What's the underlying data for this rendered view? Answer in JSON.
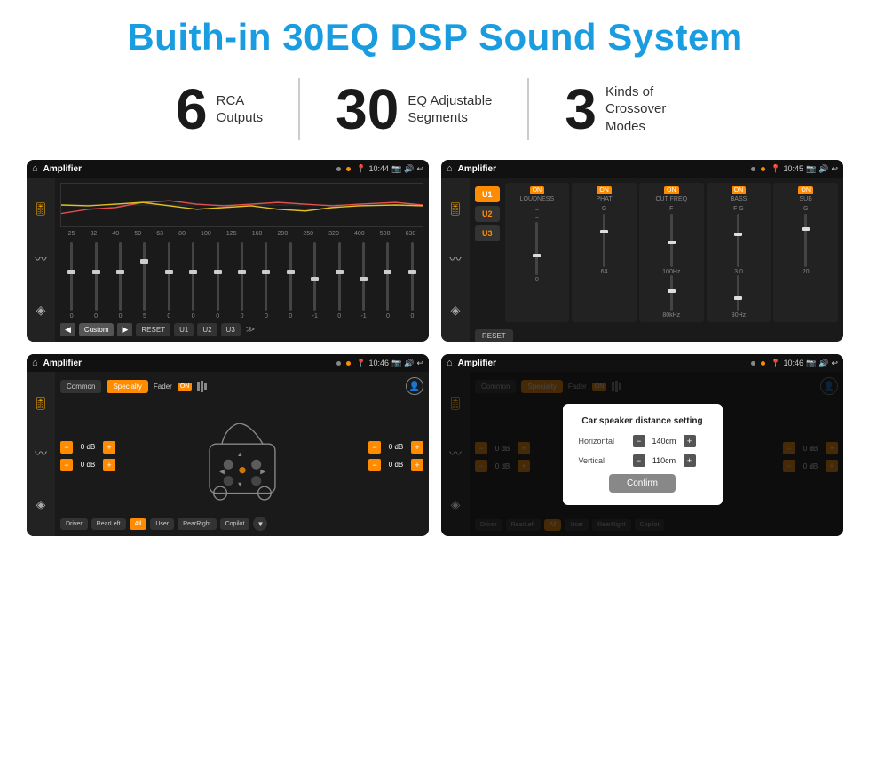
{
  "page": {
    "title": "Buith-in 30EQ DSP Sound System",
    "stats": [
      {
        "number": "6",
        "label": "RCA\nOutputs"
      },
      {
        "number": "30",
        "label": "EQ Adjustable\nSegments"
      },
      {
        "number": "3",
        "label": "Kinds of\nCrossover Modes"
      }
    ],
    "screens": [
      {
        "id": "screen1",
        "statusbar": {
          "title": "Amplifier",
          "time": "10:44"
        },
        "type": "eq"
      },
      {
        "id": "screen2",
        "statusbar": {
          "title": "Amplifier",
          "time": "10:45"
        },
        "type": "amplifier"
      },
      {
        "id": "screen3",
        "statusbar": {
          "title": "Amplifier",
          "time": "10:46"
        },
        "type": "crossover"
      },
      {
        "id": "screen4",
        "statusbar": {
          "title": "Amplifier",
          "time": "10:46"
        },
        "type": "crossover-dialog"
      }
    ],
    "eq": {
      "freqs": [
        "25",
        "32",
        "40",
        "50",
        "63",
        "80",
        "100",
        "125",
        "160",
        "200",
        "250",
        "320",
        "400",
        "500",
        "630"
      ],
      "values": [
        "0",
        "0",
        "0",
        "5",
        "0",
        "0",
        "0",
        "0",
        "0",
        "0",
        "-1",
        "0",
        "-1"
      ],
      "preset": "Custom",
      "buttons": [
        "RESET",
        "U1",
        "U2",
        "U3"
      ]
    },
    "amplifier": {
      "u_buttons": [
        "U1",
        "U2",
        "U3"
      ],
      "controls": [
        "LOUDNESS",
        "PHAT",
        "CUT FREQ",
        "BASS",
        "SUB"
      ],
      "reset_label": "RESET"
    },
    "crossover": {
      "tabs": [
        "Common",
        "Specialty"
      ],
      "fader_label": "Fader",
      "on_label": "ON",
      "buttons": [
        "Driver",
        "RearLeft",
        "All",
        "User",
        "RearRight",
        "Copilot"
      ],
      "db_values": [
        "0 dB",
        "0 dB",
        "0 dB",
        "0 dB"
      ]
    },
    "dialog": {
      "title": "Car speaker distance setting",
      "horizontal_label": "Horizontal",
      "horizontal_value": "140cm",
      "vertical_label": "Vertical",
      "vertical_value": "110cm",
      "confirm_label": "Confirm"
    }
  }
}
